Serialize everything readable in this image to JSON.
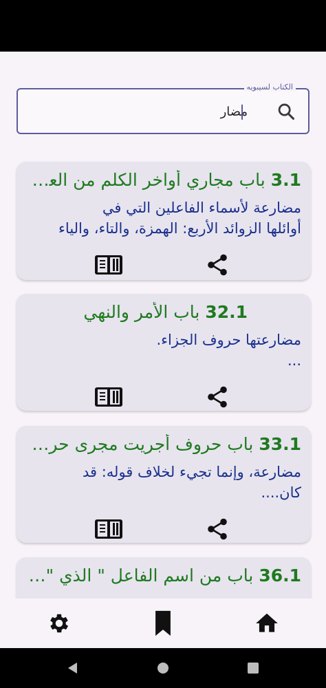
{
  "search": {
    "legend": "الكتاب لسيبويه",
    "value": "مضار"
  },
  "results": [
    {
      "number": "3.1",
      "title": "باب مجاري أواخر الكلم من العربية",
      "lines": [
        "مضارعة لأسماء الفاعلين التي في",
        "أوائلها الزوائد الأربع: الهمزة، والتاء، والياء"
      ],
      "read_icon": "book-open-icon",
      "share_icon": "share-icon"
    },
    {
      "number": "32.1",
      "title": "باب الأمر والنهي",
      "lines": [
        "مضارعتها حروف الجزاء.",
        "..."
      ],
      "read_icon": "book-open-icon",
      "share_icon": "share-icon"
    },
    {
      "number": "33.1",
      "title": "باب حروف أجريت مجرى حروف الاستفهام",
      "lines": [
        "مضارعة، وإنما تجيء لخلاف قوله: قد",
        "كان...."
      ],
      "read_icon": "book-open-icon",
      "share_icon": "share-icon"
    },
    {
      "number": "36.1",
      "title": "باب من اسم الفاعل \" الذي \" ...",
      "lines": [],
      "read_icon": "book-open-icon",
      "share_icon": "share-icon"
    }
  ],
  "bottom_nav": {
    "settings_icon": "gear-icon",
    "bookmarks_icon": "bookmark-icon",
    "home_icon": "home-icon"
  },
  "colors": {
    "title_green": "#1f7a1f",
    "body_blue": "#1a2f8c",
    "card_bg": "#e7e4ee",
    "accent": "#5d5b9e"
  }
}
